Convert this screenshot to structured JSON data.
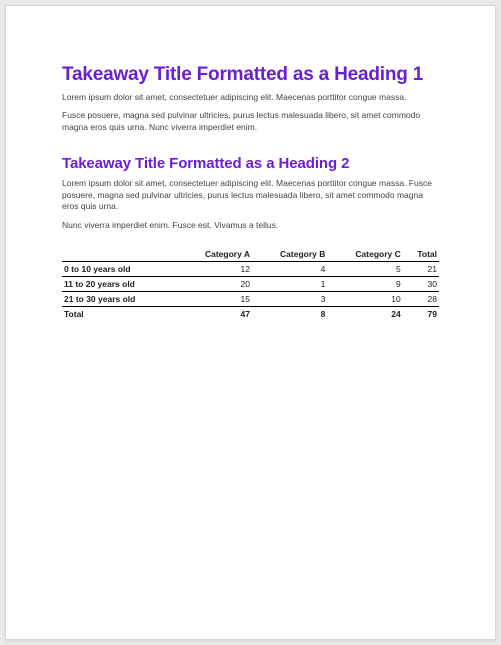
{
  "colors": {
    "heading": "#6a1fd0"
  },
  "section1": {
    "heading": "Takeaway Title Formatted as a Heading 1",
    "para1": "Lorem ipsum dolor sit amet, consectetuer adipiscing elit. Maecenas porttitor congue massa.",
    "para2": "Fusce posuere, magna sed pulvinar ultricies, purus lectus malesuada libero, sit amet commodo magna eros quis urna. Nunc viverra imperdiet enim."
  },
  "section2": {
    "heading": "Takeaway Title Formatted as a Heading 2",
    "para1": "Lorem ipsum dolor sit amet, consectetuer adipiscing elit. Maecenas porttitor congue massa. Fusce posuere, magna sed pulvinar ultricies, purus lectus malesuada libero, sit amet commodo magna eros quis urna.",
    "para2": "Nunc viverra imperdiet enim. Fusce est. Vivamus a tellus."
  },
  "table": {
    "headers": [
      "",
      "Category A",
      "Category B",
      "Category C",
      "Total"
    ],
    "rows": [
      {
        "label": "0 to 10 years old",
        "a": "12",
        "b": "4",
        "c": "5",
        "total": "21"
      },
      {
        "label": "11 to 20 years old",
        "a": "20",
        "b": "1",
        "c": "9",
        "total": "30"
      },
      {
        "label": "21 to 30 years old",
        "a": "15",
        "b": "3",
        "c": "10",
        "total": "28"
      }
    ],
    "total_row": {
      "label": "Total",
      "a": "47",
      "b": "8",
      "c": "24",
      "total": "79"
    }
  },
  "chart_data": {
    "type": "table",
    "title": "",
    "columns": [
      "Category A",
      "Category B",
      "Category C",
      "Total"
    ],
    "row_labels": [
      "0 to 10 years old",
      "11 to 20 years old",
      "21 to 30 years old",
      "Total"
    ],
    "values": [
      [
        12,
        4,
        5,
        21
      ],
      [
        20,
        1,
        9,
        30
      ],
      [
        15,
        3,
        10,
        28
      ],
      [
        47,
        8,
        24,
        79
      ]
    ]
  }
}
